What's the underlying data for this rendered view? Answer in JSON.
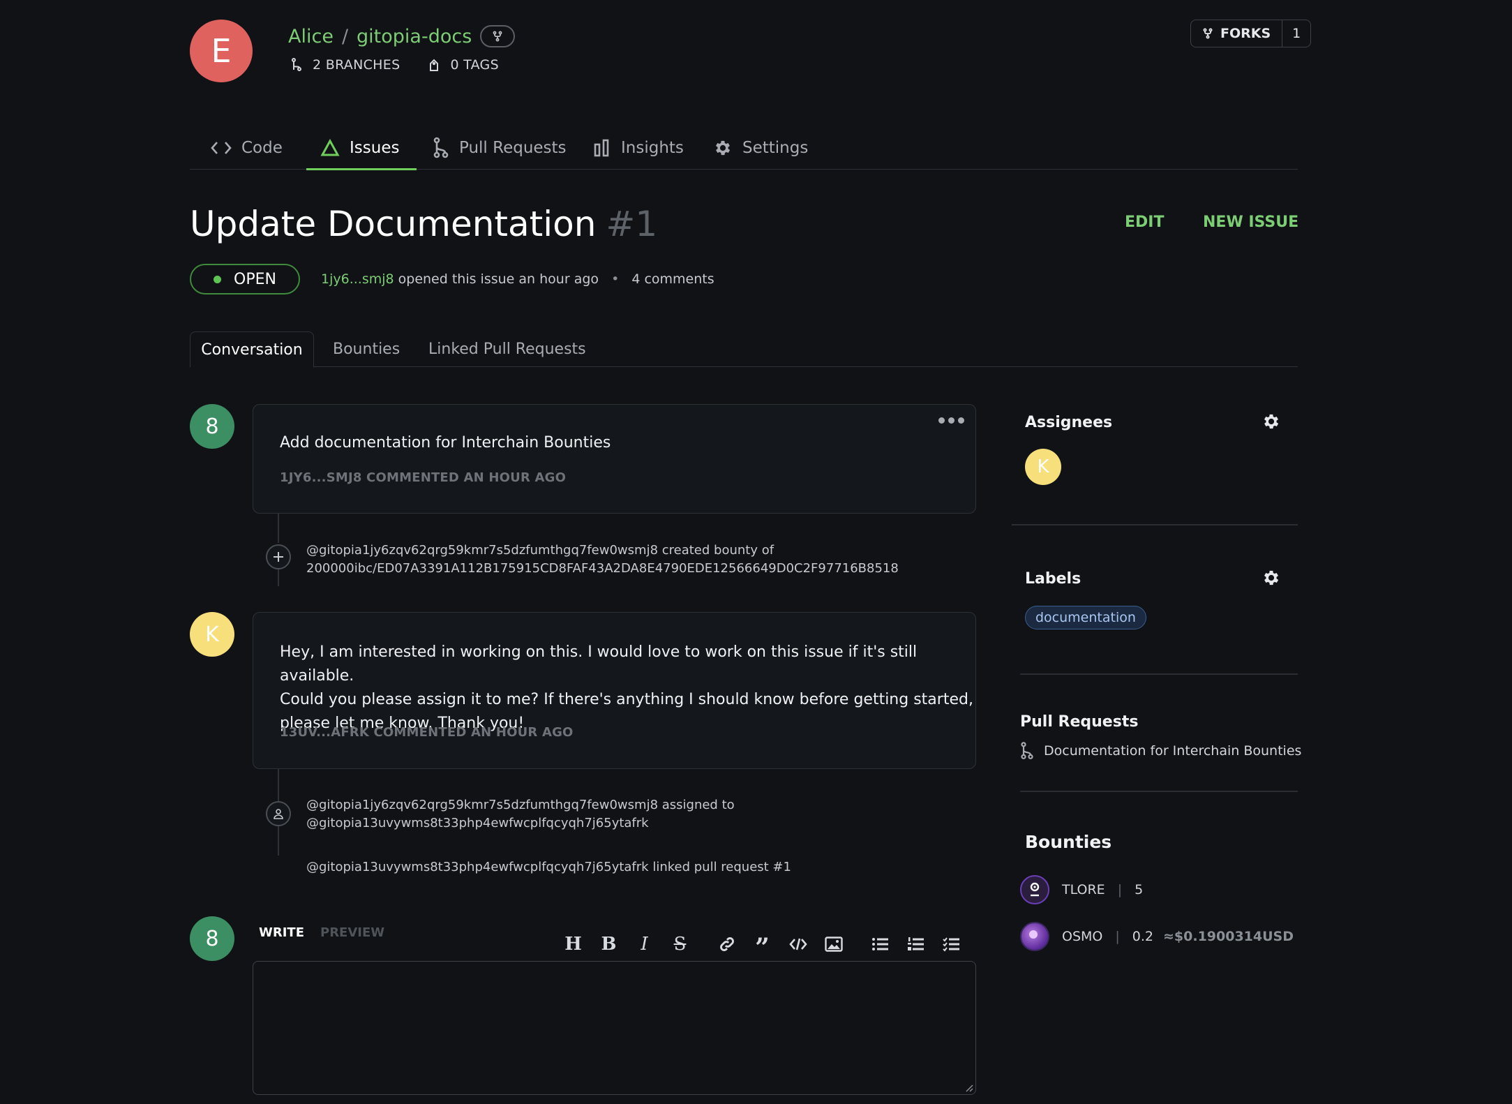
{
  "repo": {
    "avatar_letter": "E",
    "owner": "Alice",
    "separator": "/",
    "name": "gitopia-docs",
    "branches": "2 BRANCHES",
    "tags": "0 TAGS",
    "forks_label": "FORKS",
    "forks_count": "1"
  },
  "nav_tabs": [
    {
      "label": "Code",
      "icon": "code-icon"
    },
    {
      "label": "Issues",
      "icon": "issues-triangle-icon",
      "active": true
    },
    {
      "label": "Pull Requests",
      "icon": "pull-request-icon"
    },
    {
      "label": "Insights",
      "icon": "insights-bars-icon"
    },
    {
      "label": "Settings",
      "icon": "gear-icon"
    }
  ],
  "issue": {
    "title": "Update Documentation",
    "number": "#1",
    "edit_label": "EDIT",
    "new_issue_label": "NEW ISSUE",
    "status": "OPEN",
    "author": "1jy6...smj8",
    "opened_text": "opened this issue an hour ago",
    "bullet": "•",
    "comments": "4 comments"
  },
  "sub_tabs": [
    "Conversation",
    "Bounties",
    "Linked Pull Requests"
  ],
  "timeline": {
    "comment1": {
      "avatar": "8",
      "text": "Add documentation for Interchain Bounties",
      "meta": "1JY6...SMJ8 COMMENTED AN HOUR AGO"
    },
    "event1": {
      "line1": "@gitopia1jy6zqv62qrg59kmr7s5dzfumthgq7few0wsmj8 created bounty of",
      "line2": "200000ibc/ED07A3391A112B175915CD8FAF43A2DA8E4790EDE12566649D0C2F97716B8518"
    },
    "comment2": {
      "avatar": "K",
      "line1": "Hey, I am interested in working on this. I would love to work on this issue if it's still available.",
      "line2": "Could you please assign it to me? If there's anything I should know before getting started,",
      "line3": "please let me know. Thank you!",
      "meta": "13UV...AFRK COMMENTED AN HOUR AGO"
    },
    "event2": {
      "line1": "@gitopia1jy6zqv62qrg59kmr7s5dzfumthgq7few0wsmj8 assigned to",
      "line2": "@gitopia13uvywms8t33php4ewfwcplfqcyqh7j65ytafrk"
    },
    "event3": {
      "text": "@gitopia13uvywms8t33php4ewfwcplfqcyqh7j65ytafrk linked pull request #1"
    }
  },
  "composer": {
    "avatar": "8",
    "write_label": "WRITE",
    "preview_label": "PREVIEW",
    "toolbar": [
      "heading-icon",
      "bold-icon",
      "italic-icon",
      "strikethrough-icon",
      "link-icon",
      "quote-icon",
      "code-icon",
      "image-icon",
      "bullet-list-icon",
      "numbered-list-icon",
      "task-list-icon"
    ]
  },
  "sidebar": {
    "assignees_title": "Assignees",
    "assignee_avatar": "K",
    "labels_title": "Labels",
    "label": "documentation",
    "pull_requests_title": "Pull Requests",
    "pull_request": "Documentation for Interchain Bounties",
    "bounties_title": "Bounties",
    "bounties": [
      {
        "token": "TLORE",
        "amount": "5",
        "usd": ""
      },
      {
        "token": "OSMO",
        "amount": "0.2",
        "usd": "≈$0.1900314USD"
      }
    ]
  },
  "colors": {
    "accent_green": "#7ccd74",
    "background": "#101216",
    "repo_avatar": "#e0625f",
    "avatar_green": "#3c8f63",
    "avatar_yellow": "#f7df7c",
    "label_blue": "#a8c6f2"
  }
}
